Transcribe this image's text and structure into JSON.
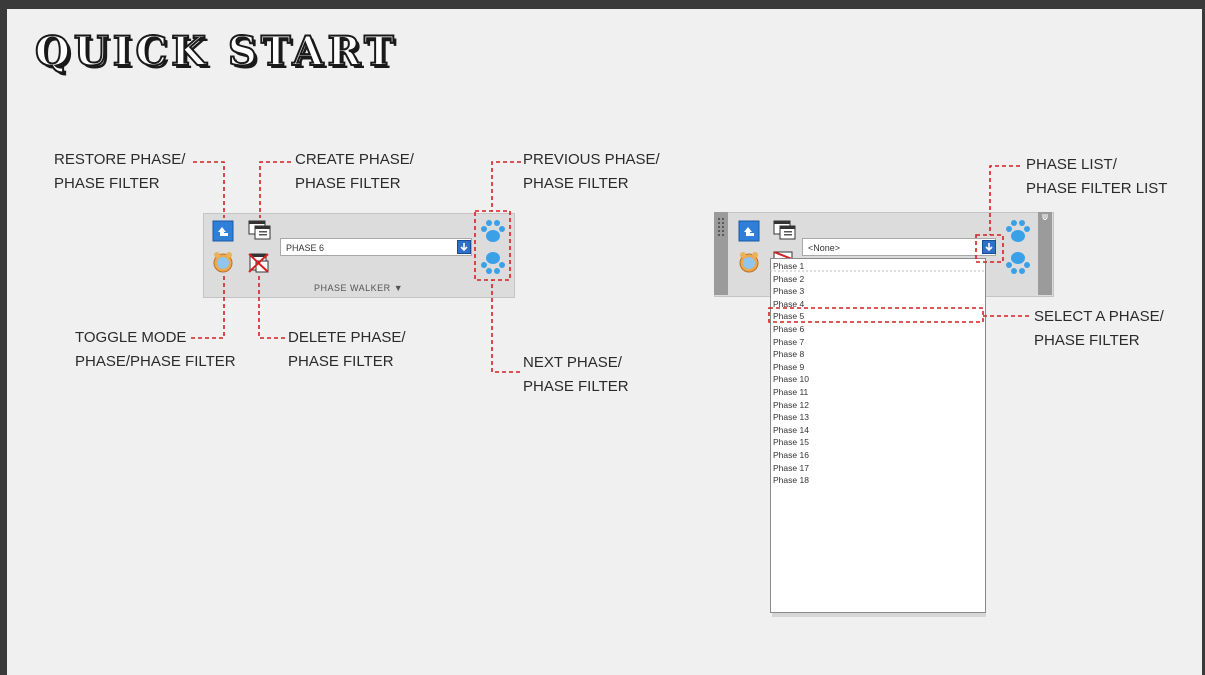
{
  "title": "QUICK START",
  "callouts": {
    "restore": [
      "RESTORE PHASE/",
      "PHASE FILTER"
    ],
    "create": [
      "CREATE PHASE/",
      "PHASE FILTER"
    ],
    "previous": [
      "PREVIOUS PHASE/",
      "PHASE FILTER"
    ],
    "toggle": [
      "TOGGLE MODE",
      "PHASE/PHASE FILTER"
    ],
    "delete": [
      "DELETE PHASE/",
      "PHASE FILTER"
    ],
    "next": [
      "NEXT PHASE/",
      "PHASE FILTER"
    ],
    "phase_list": [
      "PHASE LIST/",
      "PHASE FILTER LIST"
    ],
    "select": [
      "SELECT A PHASE/",
      "PHASE FILTER"
    ]
  },
  "left_palette": {
    "current_phase": "PHASE 6",
    "panel_label": "PHASE WALKER"
  },
  "right_palette": {
    "current_phase": "<None>",
    "phases": [
      "Phase 1",
      "Phase 2",
      "Phase 3",
      "Phase 4",
      "Phase 5",
      "Phase 6",
      "Phase 7",
      "Phase 8",
      "Phase 9",
      "Phase 10",
      "Phase 11",
      "Phase 12",
      "Phase 13",
      "Phase 14",
      "Phase 15",
      "Phase 16",
      "Phase 17",
      "Phase 18"
    ]
  },
  "colors": {
    "callout": "#d42020",
    "accent": "#2f6fc6",
    "paw": "#3aa0e8"
  }
}
